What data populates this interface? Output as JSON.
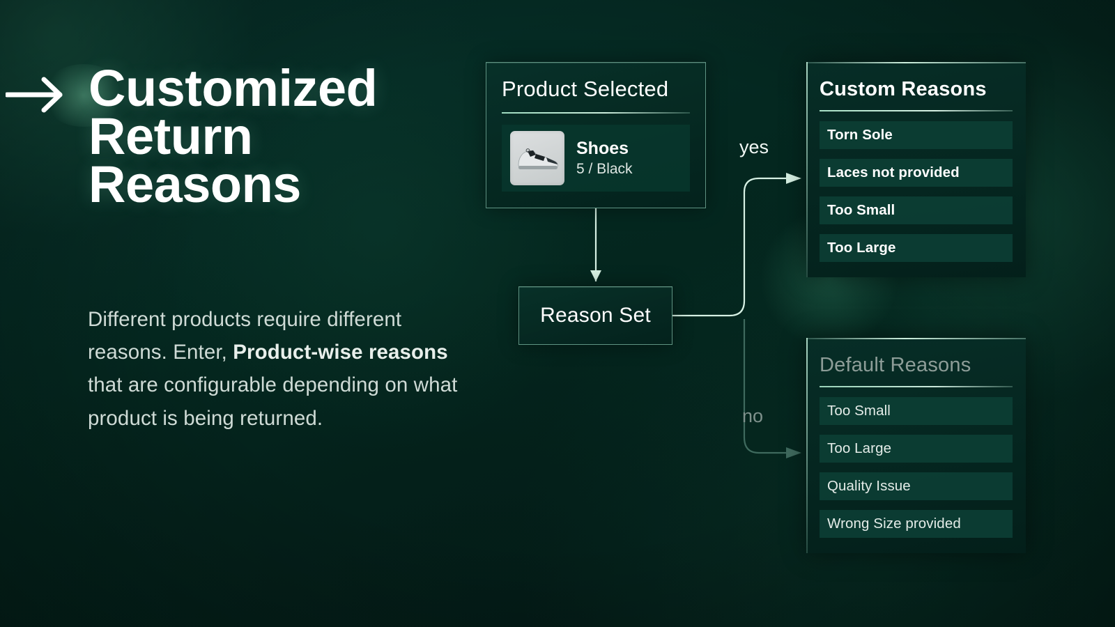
{
  "slide": {
    "headline_lines": [
      "Customized",
      "Return",
      "Reasons"
    ],
    "body_part1": "Different products require different reasons. Enter, ",
    "body_strong": "Product-wise reasons",
    "body_part2": " that are configurable depending on what product is being returned."
  },
  "diagram": {
    "product_card": {
      "title": "Product Selected",
      "product_name": "Shoes",
      "product_variant": "5 / Black"
    },
    "decision_node": {
      "label": "Reason Set"
    },
    "edges": {
      "yes_label": "yes",
      "no_label": "no"
    },
    "custom_panel": {
      "title": "Custom Reasons",
      "reasons": [
        "Torn Sole",
        "Laces not provided",
        "Too Small",
        "Too Large"
      ]
    },
    "default_panel": {
      "title": "Default Reasons",
      "reasons": [
        "Too Small",
        "Too Large",
        "Quality Issue",
        "Wrong Size provided"
      ]
    }
  },
  "colors": {
    "background": "#042620",
    "accent_line": "#cdeedd",
    "text_primary": "#ffffff",
    "text_muted": "#8d9d98",
    "chip_bg": "#0c3d34"
  }
}
